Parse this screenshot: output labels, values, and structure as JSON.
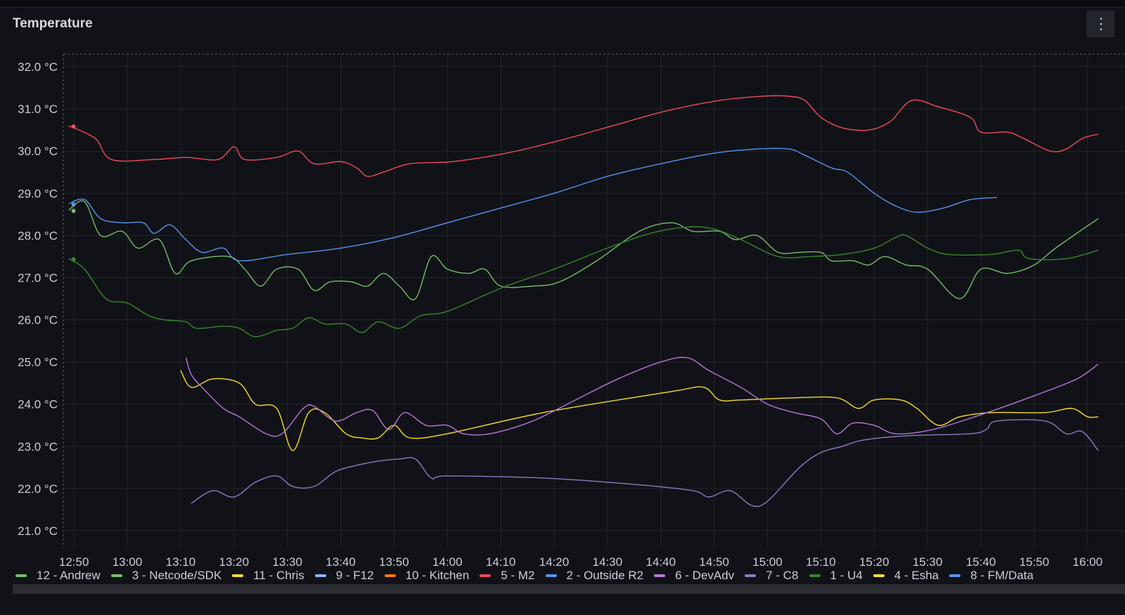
{
  "panel": {
    "title": "Temperature",
    "menu_icon": "menu-icon"
  },
  "chart_data": {
    "type": "line",
    "title": "Temperature",
    "xlabel": "",
    "ylabel": "",
    "y_unit": "°C",
    "ylim": [
      20.6,
      32.3
    ],
    "xlim_minutes": [
      768,
      962
    ],
    "x_ticks": [
      "12:50",
      "13:00",
      "13:10",
      "13:20",
      "13:30",
      "13:40",
      "13:50",
      "14:00",
      "14:10",
      "14:20",
      "14:30",
      "14:40",
      "14:50",
      "15:00",
      "15:10",
      "15:20",
      "15:30",
      "15:40",
      "15:50",
      "16:00"
    ],
    "y_ticks": [
      "32.0 °C",
      "31.0 °C",
      "30.0 °C",
      "29.0 °C",
      "28.0 °C",
      "27.0 °C",
      "26.0 °C",
      "25.0 °C",
      "24.0 °C",
      "23.0 °C",
      "22.0 °C",
      "21.0 °C"
    ],
    "y_tick_values": [
      32,
      31,
      30,
      29,
      28,
      27,
      26,
      25,
      24,
      23,
      22,
      21
    ],
    "grid": true,
    "legend_position": "bottom",
    "series": [
      {
        "name": "12 - Andrew",
        "color": "#73bf69",
        "points": []
      },
      {
        "name": "3 - Netcode/SDK",
        "color": "#73bf69",
        "points": [
          [
            "12:49",
            28.6
          ],
          [
            "12:52",
            28.8
          ],
          [
            "12:55",
            28.0
          ],
          [
            "12:59",
            28.1
          ],
          [
            "13:02",
            27.7
          ],
          [
            "13:06",
            27.9
          ],
          [
            "13:09",
            27.1
          ],
          [
            "13:12",
            27.4
          ],
          [
            "13:19",
            27.5
          ],
          [
            "13:22",
            27.2
          ],
          [
            "13:25",
            26.8
          ],
          [
            "13:28",
            27.2
          ],
          [
            "13:32",
            27.2
          ],
          [
            "13:35",
            26.7
          ],
          [
            "13:38",
            26.9
          ],
          [
            "13:42",
            26.9
          ],
          [
            "13:45",
            26.8
          ],
          [
            "13:48",
            27.1
          ],
          [
            "13:51",
            26.8
          ],
          [
            "13:54",
            26.5
          ],
          [
            "13:57",
            27.5
          ],
          [
            "14:00",
            27.2
          ],
          [
            "14:04",
            27.1
          ],
          [
            "14:07",
            27.2
          ],
          [
            "14:10",
            26.8
          ],
          [
            "14:16",
            26.8
          ],
          [
            "14:21",
            26.9
          ],
          [
            "14:28",
            27.4
          ],
          [
            "14:36",
            28.1
          ],
          [
            "14:42",
            28.3
          ],
          [
            "14:46",
            28.1
          ],
          [
            "14:51",
            28.1
          ],
          [
            "14:54",
            27.9
          ],
          [
            "14:58",
            28.0
          ],
          [
            "15:02",
            27.6
          ],
          [
            "15:06",
            27.6
          ],
          [
            "15:10",
            27.6
          ],
          [
            "15:12",
            27.4
          ],
          [
            "15:16",
            27.4
          ],
          [
            "15:19",
            27.3
          ],
          [
            "15:22",
            27.5
          ],
          [
            "15:26",
            27.3
          ],
          [
            "15:30",
            27.2
          ],
          [
            "15:36",
            26.5
          ],
          [
            "15:40",
            27.2
          ],
          [
            "15:45",
            27.1
          ],
          [
            "15:50",
            27.3
          ],
          [
            "15:54",
            27.7
          ],
          [
            "16:02",
            28.4
          ]
        ]
      },
      {
        "name": "11 - Chris",
        "color": "#fade2a",
        "points": [
          [
            "13:10",
            24.8
          ],
          [
            "13:12",
            24.4
          ],
          [
            "13:16",
            24.6
          ],
          [
            "13:21",
            24.5
          ],
          [
            "13:24",
            24.0
          ],
          [
            "13:28",
            23.9
          ],
          [
            "13:31",
            22.9
          ],
          [
            "13:34",
            23.8
          ],
          [
            "13:37",
            23.8
          ],
          [
            "13:41",
            23.3
          ],
          [
            "13:44",
            23.2
          ],
          [
            "13:47",
            23.2
          ],
          [
            "13:50",
            23.5
          ],
          [
            "13:53",
            23.2
          ],
          [
            "14:00",
            23.3
          ],
          [
            "14:18",
            23.8
          ],
          [
            "14:42",
            24.3
          ],
          [
            "14:48",
            24.4
          ],
          [
            "14:51",
            24.1
          ],
          [
            "14:55",
            24.1
          ],
          [
            "15:05",
            24.15
          ],
          [
            "15:13",
            24.15
          ],
          [
            "15:17",
            23.9
          ],
          [
            "15:20",
            24.1
          ],
          [
            "15:25",
            24.1
          ],
          [
            "15:28",
            23.9
          ],
          [
            "15:32",
            23.5
          ],
          [
            "15:36",
            23.7
          ],
          [
            "15:42",
            23.8
          ],
          [
            "15:52",
            23.8
          ],
          [
            "15:57",
            23.9
          ],
          [
            "16:00",
            23.7
          ],
          [
            "16:02",
            23.7
          ]
        ]
      },
      {
        "name": "9 - F12",
        "color": "#8ab8ff",
        "points": []
      },
      {
        "name": "10 - Kitchen",
        "color": "#ff780a",
        "points": []
      },
      {
        "name": "5 - M2",
        "color": "#f2495c",
        "points": [
          [
            "12:49",
            30.6
          ],
          [
            "12:54",
            30.3
          ],
          [
            "12:57",
            29.8
          ],
          [
            "13:05",
            29.8
          ],
          [
            "13:11",
            29.85
          ],
          [
            "13:17",
            29.8
          ],
          [
            "13:20",
            30.1
          ],
          [
            "13:22",
            29.8
          ],
          [
            "13:28",
            29.85
          ],
          [
            "13:32",
            30.0
          ],
          [
            "13:35",
            29.7
          ],
          [
            "13:40",
            29.75
          ],
          [
            "13:43",
            29.6
          ],
          [
            "13:45",
            29.4
          ],
          [
            "13:48",
            29.5
          ],
          [
            "13:53",
            29.7
          ],
          [
            "14:01",
            29.75
          ],
          [
            "14:11",
            29.95
          ],
          [
            "14:21",
            30.25
          ],
          [
            "14:31",
            30.6
          ],
          [
            "14:41",
            30.95
          ],
          [
            "14:51",
            31.2
          ],
          [
            "14:59",
            31.3
          ],
          [
            "15:04",
            31.3
          ],
          [
            "15:07",
            31.2
          ],
          [
            "15:10",
            30.8
          ],
          [
            "15:14",
            30.55
          ],
          [
            "15:19",
            30.5
          ],
          [
            "15:23",
            30.7
          ],
          [
            "15:27",
            31.2
          ],
          [
            "15:32",
            31.05
          ],
          [
            "15:38",
            30.8
          ],
          [
            "15:40",
            30.45
          ],
          [
            "15:45",
            30.45
          ],
          [
            "15:48",
            30.3
          ],
          [
            "15:53",
            30.0
          ],
          [
            "15:56",
            30.05
          ],
          [
            "15:59",
            30.3
          ],
          [
            "16:02",
            30.4
          ]
        ]
      },
      {
        "name": "2 - Outside R2",
        "color": "#5794f2",
        "points": [
          [
            "12:49",
            28.75
          ],
          [
            "12:52",
            28.85
          ],
          [
            "12:55",
            28.4
          ],
          [
            "12:59",
            28.3
          ],
          [
            "13:03",
            28.3
          ],
          [
            "13:05",
            28.05
          ],
          [
            "13:08",
            28.25
          ],
          [
            "13:11",
            27.9
          ],
          [
            "13:14",
            27.6
          ],
          [
            "13:18",
            27.7
          ],
          [
            "13:21",
            27.4
          ],
          [
            "13:30",
            27.55
          ],
          [
            "13:40",
            27.7
          ],
          [
            "13:50",
            27.95
          ],
          [
            "14:00",
            28.3
          ],
          [
            "14:10",
            28.65
          ],
          [
            "14:20",
            29.0
          ],
          [
            "14:30",
            29.4
          ],
          [
            "14:40",
            29.7
          ],
          [
            "14:50",
            29.95
          ],
          [
            "14:58",
            30.05
          ],
          [
            "15:04",
            30.05
          ],
          [
            "15:07",
            29.9
          ],
          [
            "15:12",
            29.6
          ],
          [
            "15:15",
            29.5
          ],
          [
            "15:20",
            29.0
          ],
          [
            "15:24",
            28.7
          ],
          [
            "15:28",
            28.55
          ],
          [
            "15:33",
            28.65
          ],
          [
            "15:38",
            28.85
          ],
          [
            "15:43",
            28.9
          ]
        ]
      },
      {
        "name": "6 - DevAdv",
        "color": "#b877d9",
        "points": [
          [
            "13:11",
            25.1
          ],
          [
            "13:12",
            24.7
          ],
          [
            "13:14",
            24.4
          ],
          [
            "13:18",
            23.9
          ],
          [
            "13:21",
            23.7
          ],
          [
            "13:26",
            23.3
          ],
          [
            "13:29",
            23.3
          ],
          [
            "13:33",
            23.9
          ],
          [
            "13:35",
            23.95
          ],
          [
            "13:39",
            23.6
          ],
          [
            "13:43",
            23.8
          ],
          [
            "13:46",
            23.85
          ],
          [
            "13:49",
            23.4
          ],
          [
            "13:52",
            23.8
          ],
          [
            "13:56",
            23.5
          ],
          [
            "14:00",
            23.5
          ],
          [
            "14:03",
            23.3
          ],
          [
            "14:08",
            23.3
          ],
          [
            "14:16",
            23.6
          ],
          [
            "14:24",
            24.1
          ],
          [
            "14:32",
            24.6
          ],
          [
            "14:40",
            25.0
          ],
          [
            "14:45",
            25.1
          ],
          [
            "14:49",
            24.8
          ],
          [
            "14:55",
            24.4
          ],
          [
            "15:00",
            24.0
          ],
          [
            "15:05",
            23.8
          ],
          [
            "15:10",
            23.65
          ],
          [
            "15:13",
            23.3
          ],
          [
            "15:16",
            23.55
          ],
          [
            "15:20",
            23.5
          ],
          [
            "15:24",
            23.3
          ],
          [
            "15:31",
            23.4
          ],
          [
            "15:40",
            23.75
          ],
          [
            "15:50",
            24.2
          ],
          [
            "15:58",
            24.6
          ],
          [
            "16:02",
            24.95
          ]
        ]
      },
      {
        "name": "7 - C8",
        "color": "#8f7ac2",
        "points": [
          [
            "13:12",
            21.65
          ],
          [
            "13:16",
            21.95
          ],
          [
            "13:20",
            21.8
          ],
          [
            "13:24",
            22.15
          ],
          [
            "13:28",
            22.3
          ],
          [
            "13:31",
            22.05
          ],
          [
            "13:35",
            22.05
          ],
          [
            "13:39",
            22.4
          ],
          [
            "13:43",
            22.55
          ],
          [
            "13:47",
            22.65
          ],
          [
            "13:51",
            22.7
          ],
          [
            "13:54",
            22.7
          ],
          [
            "13:57",
            22.25
          ],
          [
            "14:00",
            22.3
          ],
          [
            "14:18",
            22.25
          ],
          [
            "14:35",
            22.1
          ],
          [
            "14:46",
            21.95
          ],
          [
            "14:49",
            21.8
          ],
          [
            "14:53",
            21.95
          ],
          [
            "14:57",
            21.6
          ],
          [
            "15:00",
            21.7
          ],
          [
            "15:06",
            22.5
          ],
          [
            "15:10",
            22.85
          ],
          [
            "15:14",
            23.0
          ],
          [
            "15:18",
            23.15
          ],
          [
            "15:26",
            23.25
          ],
          [
            "15:38",
            23.3
          ],
          [
            "15:41",
            23.4
          ],
          [
            "15:43",
            23.6
          ],
          [
            "15:52",
            23.6
          ],
          [
            "15:56",
            23.3
          ],
          [
            "15:59",
            23.35
          ],
          [
            "16:02",
            22.9
          ]
        ]
      },
      {
        "name": "1 - U4",
        "color": "#37872d",
        "points": [
          [
            "12:49",
            27.45
          ],
          [
            "12:52",
            27.2
          ],
          [
            "12:56",
            26.5
          ],
          [
            "13:00",
            26.4
          ],
          [
            "13:04",
            26.1
          ],
          [
            "13:07",
            26.0
          ],
          [
            "13:11",
            25.95
          ],
          [
            "13:13",
            25.8
          ],
          [
            "13:18",
            25.85
          ],
          [
            "13:21",
            25.8
          ],
          [
            "13:24",
            25.6
          ],
          [
            "13:28",
            25.75
          ],
          [
            "13:31",
            25.8
          ],
          [
            "13:34",
            26.05
          ],
          [
            "13:37",
            25.9
          ],
          [
            "13:41",
            25.9
          ],
          [
            "13:44",
            25.7
          ],
          [
            "13:47",
            25.95
          ],
          [
            "13:51",
            25.8
          ],
          [
            "13:55",
            26.1
          ],
          [
            "14:00",
            26.2
          ],
          [
            "14:10",
            26.75
          ],
          [
            "14:20",
            27.2
          ],
          [
            "14:30",
            27.7
          ],
          [
            "14:38",
            28.05
          ],
          [
            "14:45",
            28.2
          ],
          [
            "14:50",
            28.15
          ],
          [
            "14:55",
            27.9
          ],
          [
            "15:02",
            27.5
          ],
          [
            "15:08",
            27.5
          ],
          [
            "15:14",
            27.55
          ],
          [
            "15:20",
            27.7
          ],
          [
            "15:24",
            27.95
          ],
          [
            "15:26",
            28.0
          ],
          [
            "15:30",
            27.7
          ],
          [
            "15:34",
            27.55
          ],
          [
            "15:42",
            27.55
          ],
          [
            "15:47",
            27.65
          ],
          [
            "15:49",
            27.45
          ],
          [
            "15:56",
            27.45
          ],
          [
            "16:02",
            27.65
          ]
        ]
      },
      {
        "name": "4 - Esha",
        "color": "#fade2a",
        "points": []
      },
      {
        "name": "8 - FM/Data",
        "color": "#5794f2",
        "points": []
      }
    ]
  }
}
